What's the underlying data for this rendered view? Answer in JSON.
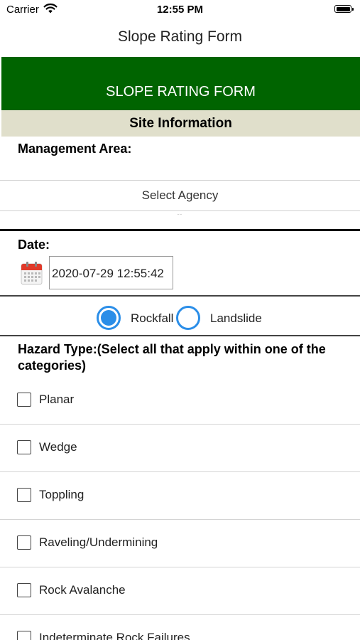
{
  "status_bar": {
    "carrier": "Carrier",
    "time": "12:55 PM"
  },
  "nav": {
    "title": "Slope Rating Form"
  },
  "banner": {
    "title": "SLOPE RATING FORM"
  },
  "site_section": {
    "title": "Site Information"
  },
  "management": {
    "label": "Management Area:",
    "select_value": "Select Agency"
  },
  "date": {
    "label": "Date:",
    "value": "2020-07-29 12:55:42"
  },
  "hazard_category": {
    "options": [
      {
        "label": "Rockfall",
        "selected": true
      },
      {
        "label": "Landslide",
        "selected": false
      }
    ]
  },
  "hazard_type": {
    "title": "Hazard Type:(Select all that apply within one of the categories)",
    "options": [
      {
        "label": "Planar",
        "checked": false
      },
      {
        "label": "Wedge",
        "checked": false
      },
      {
        "label": "Toppling",
        "checked": false
      },
      {
        "label": "Raveling/Undermining",
        "checked": false
      },
      {
        "label": "Rock Avalanche",
        "checked": false
      },
      {
        "label": "Indeterminate Rock Failures",
        "checked": false
      }
    ]
  },
  "colors": {
    "banner": "#006400",
    "section": "#e0dfcb",
    "radio": "#2b8ee8"
  }
}
